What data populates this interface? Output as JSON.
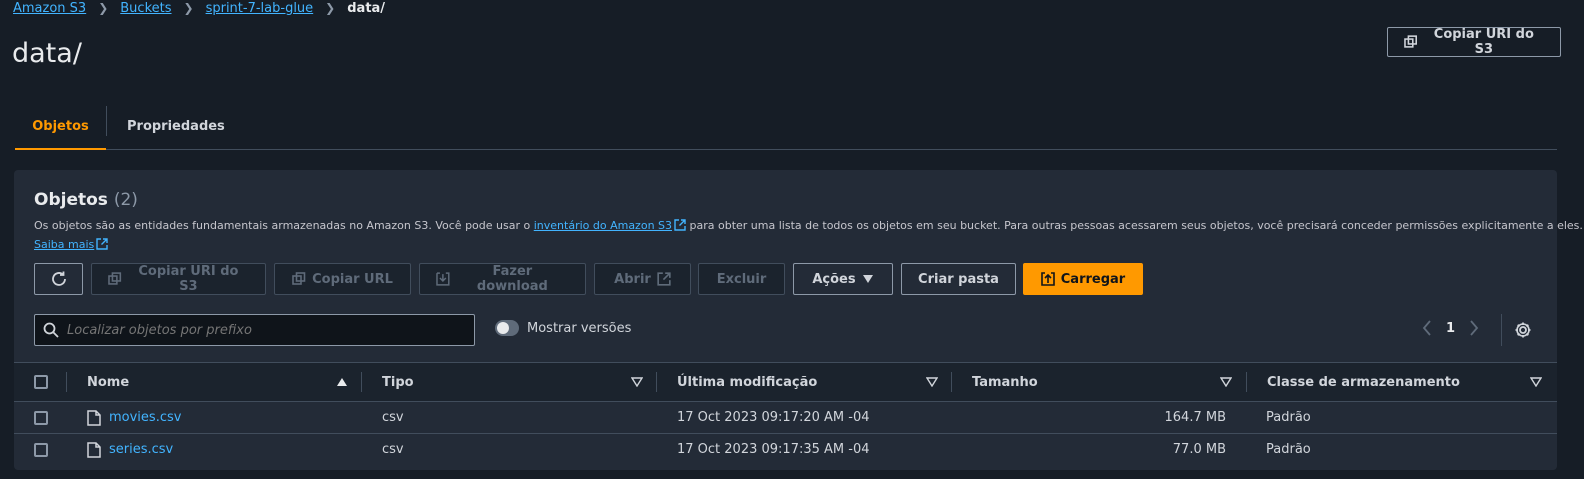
{
  "breadcrumb": {
    "items": [
      "Amazon S3",
      "Buckets",
      "sprint-7-lab-glue"
    ],
    "current": "data/"
  },
  "page": {
    "title": "data/",
    "copy_uri_label": "Copiar URI do S3"
  },
  "tabs": [
    {
      "label": "Objetos",
      "active": true
    },
    {
      "label": "Propriedades",
      "active": false
    }
  ],
  "objects_panel": {
    "title": "Objetos",
    "count": "(2)",
    "desc_before": "Os objetos são as entidades fundamentais armazenadas no Amazon S3. Você pode usar o",
    "desc_link": "inventário do Amazon S3",
    "desc_after": "para obter uma lista de todos os objetos em seu bucket. Para outras pessoas acessarem seus objetos, você precisará conceder permissões explicitamente a eles.",
    "learn_more": "Saiba mais"
  },
  "toolbar": {
    "copy_uri": "Copiar URI do S3",
    "copy_url": "Copiar URL",
    "download": "Fazer download",
    "open": "Abrir",
    "delete": "Excluir",
    "actions": "Ações",
    "create_folder": "Criar pasta",
    "upload": "Carregar"
  },
  "search": {
    "placeholder": "Localizar objetos por prefixo"
  },
  "versions_toggle": {
    "label": "Mostrar versões",
    "on": false
  },
  "pagination": {
    "page": "1"
  },
  "table": {
    "columns": [
      "Nome",
      "Tipo",
      "Última modificação",
      "Tamanho",
      "Classe de armazenamento"
    ],
    "rows": [
      {
        "name": "movies.csv",
        "type": "csv",
        "modified": "17 Oct 2023 09:17:20 AM -04",
        "size": "164.7 MB",
        "storage_class": "Padrão"
      },
      {
        "name": "series.csv",
        "type": "csv",
        "modified": "17 Oct 2023 09:17:35 AM -04",
        "size": "77.0 MB",
        "storage_class": "Padrão"
      }
    ]
  },
  "colors": {
    "accent": "#ff9900",
    "link": "#42b4ff",
    "background": "#161d26",
    "panel": "#232b37"
  }
}
